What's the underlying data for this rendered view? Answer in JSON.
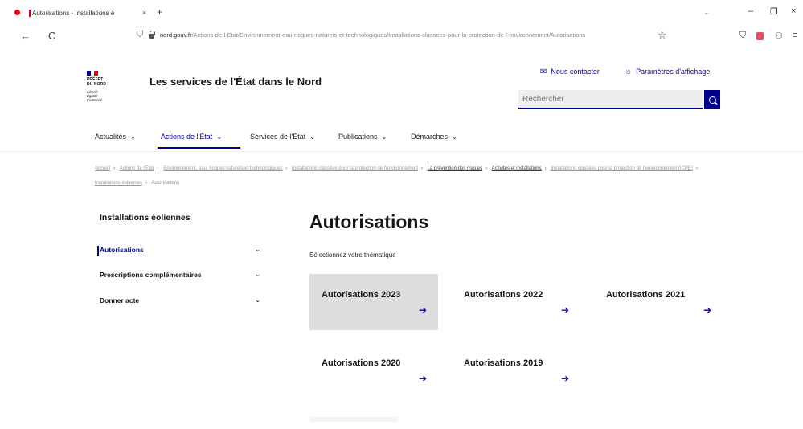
{
  "browser": {
    "tab_title": "Autorisations - Installations é",
    "tab_close": "×",
    "new_tab": "+",
    "back": "←",
    "reload": "C",
    "url_domain": "nord.gouv.fr",
    "url_rest": "/Actions-de-l-Etat/Environnement-eau-risques-naturels-et-technologiques/Installations-classees-pour-la-protection-de-l-environnement/Autorisations",
    "bookmark": "☆",
    "win_dropdown": "⌄",
    "win_min": "–",
    "win_restore": "❐",
    "win_close": "×"
  },
  "header": {
    "logo_lines": [
      "PRÉFET",
      "DU NORD"
    ],
    "logo_motto": [
      "Liberté",
      "Égalité",
      "Fraternité"
    ],
    "site_title": "Les services de l'État dans le Nord",
    "contact_label": "Nous contacter",
    "display_label": "Paramètres d'affichage",
    "search_placeholder": "Rechercher"
  },
  "nav": {
    "items": [
      "Actualités",
      "Actions de l'État",
      "Services de l'État",
      "Publications",
      "Démarches"
    ]
  },
  "breadcrumb": {
    "items": [
      "Accueil",
      "Actions de l'État",
      "Environnement, eau, risques naturels et technologiques",
      "Installations classées pour la protection de l'environnement",
      "La prévention des risques",
      "Activités et installations",
      "Installations classées pour la protection de l'environnement (ICPE)",
      "Installations éoliennes"
    ],
    "current": "Autorisations"
  },
  "sidebar": {
    "title": "Installations éoliennes",
    "items": [
      {
        "label": "Autorisations",
        "active": true
      },
      {
        "label": "Prescriptions complémentaires",
        "active": false
      },
      {
        "label": "Donner acte",
        "active": false
      }
    ]
  },
  "main": {
    "title": "Autorisations",
    "subtitle": "Sélectionnez votre thématique",
    "tiles": [
      {
        "label": "Autorisations 2023",
        "selected": true
      },
      {
        "label": "Autorisations 2022",
        "selected": false
      },
      {
        "label": "Autorisations 2021",
        "selected": false
      },
      {
        "label": "Autorisations 2020",
        "selected": false
      },
      {
        "label": "Autorisations 2019",
        "selected": false
      }
    ]
  },
  "colors": {
    "primary": "#000091",
    "red": "#e1000f",
    "tile_selected_bg": "#dddddd",
    "search_bg": "#eeeeee"
  }
}
